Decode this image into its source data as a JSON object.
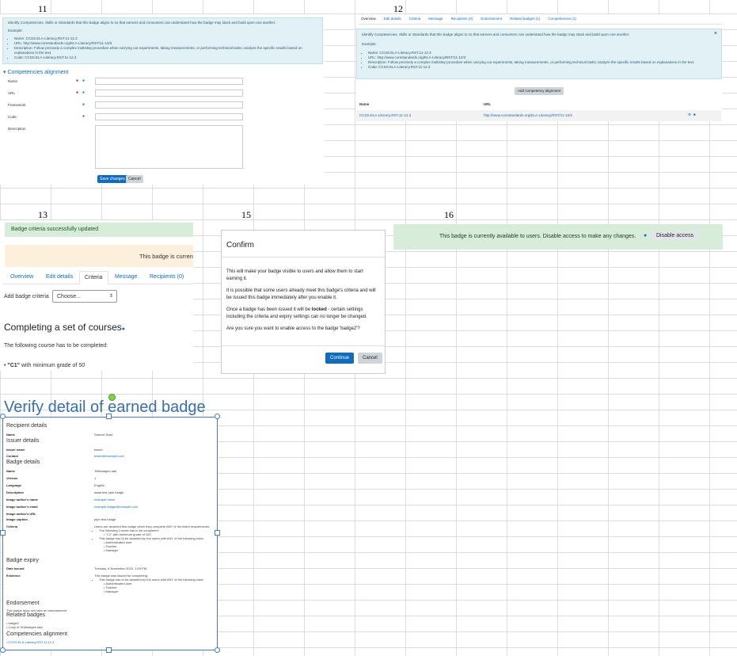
{
  "labels": {
    "s11": "11",
    "s12": "12",
    "s13": "13",
    "s15": "15",
    "s16": "16"
  },
  "p11": {
    "info": "Identify Competencies, Skills or Standards that this badge aligns to so that earners and consumers can understand how the badge may stack and build upon one another.",
    "example": "Example:",
    "ex1": "Name: CCSS.ELA-Literacy.RST.11-12.3",
    "ex2": "URL: http://www.corestandards.org/ELA-Literacy/RST/11-12/3",
    "ex3": "Description: Follow precisely a complex multistep procedure when carrying out experiments, taking measurements, or performing technical tasks; analyze the specific results based on explanations in the text.",
    "ex4": "Code: CCSS.ELA-Literacy.RST.11-12.3",
    "heading": "Competencies alignment",
    "f_name": "Name",
    "f_url": "URL",
    "f_framework": "Framework",
    "f_code": "Code",
    "f_desc": "Description",
    "save": "Save changes",
    "cancel": "Cancel"
  },
  "p12": {
    "tabs": [
      "Overview",
      "Edit details",
      "Criteria",
      "Message",
      "Recipients (0)",
      "Endorsement",
      "Related badges (1)",
      "Competencies (1)"
    ],
    "info": "Identify Competencies, Skills or Standards that this badge aligns to so that earners and consumers can understand how the badge may stack and build upon one another.",
    "example": "Example:",
    "ex1": "Name: CCSS.ELA-Literacy.RST.11-12.3",
    "ex2": "URL: http://www.corestandards.org/ELA-Literacy/RST/11-12/3",
    "ex3": "Description: Follow precisely a complex multistep procedure when carrying out experiments, taking measurements, or performing technical tasks; analyze the specific results based on explanations in the text.",
    "ex4": "Code: CCSS.ELA-Literacy.RST.11-12.3",
    "add": "Add competency alignment",
    "col_name": "Name",
    "col_url": "URL",
    "row_name": "CCSS.ELA-Literacy.RST.11-12.3",
    "row_url": "http://www.corestandards.org/ELA-Literacy/RST/11-12/3"
  },
  "p13": {
    "success": "Badge criteria successfully updated",
    "warning": "This badge is currently",
    "tabs": [
      "Overview",
      "Edit details",
      "Criteria",
      "Message",
      "Recipients (0)"
    ],
    "add_label": "Add badge criteria",
    "select": "Choose...",
    "heading": "Completing a set of courses",
    "sub": "The following course has to be completed:",
    "item_course": "\"C1\"",
    "item_rest": " with minimum grade of ",
    "item_grade": "50"
  },
  "p15": {
    "title": "Confirm",
    "p1": "This will make your badge visible to users and allow them to start earning it.",
    "p2": "It is possible that some users already meet this badge's criteria and will be issued this badge immediately after you enable it.",
    "p3a": "Once a badge has been issued it will be ",
    "p3b": "locked",
    "p3c": " - certain settings including the criteria and expiry settings can no longer be changed.",
    "p4": "Are you sure you want to enable access to the badge 'badge2'?",
    "continue": "Continue",
    "cancel": "Cancel"
  },
  "p16": {
    "text": "This badge is currently available to users. Disable access to make any changes.",
    "button": "Disable access"
  },
  "verify": {
    "title": "Verify detail of earned badge",
    "h_recipient": "Recipient details",
    "name_l": "Name",
    "name_v": "Samuel Salvi",
    "h_issuer": "Issuer details",
    "iname_l": "Issuer name",
    "iname_v": "Issuer",
    "contact_l": "Contact",
    "contact_v": "tester@example.com",
    "h_badge": "Badge details",
    "bname_l": "Name",
    "bname_v": "Testbadges aaa",
    "version_l": "Version",
    "version_v": "1",
    "lang_l": "Language",
    "lang_v": "English",
    "desc_l": "Description",
    "desc_v": "aaaa test pipe badge",
    "iauth_l": "Image author's name",
    "iauth_v": "example name",
    "iemail_l": "Image author's email",
    "iemail_v": "example-image@example.com",
    "iurl_l": "Image author's URL",
    "icap_l": "Image caption",
    "icap_v": "pipe test badge",
    "crit_l": "Criteria",
    "crit_v": "Users are awarded this badge when they complete ANY of the listed requirements:",
    "crit_1": "The following Course has to be completed:",
    "crit_1a": "\"C1\" with minimum grade of 100",
    "crit_2": "This badge has to be awarded by the users with ANY of the following roles:",
    "roles": [
      "Authenticated user",
      "Teacher",
      "Manager"
    ],
    "h_expiry": "Badge expiry",
    "issued_l": "Date issued",
    "issued_v": "Tuesday, 6 November 2019, 1:53 PM",
    "evid_l": "Evidence",
    "evid_v": "This badge was issued for completing:",
    "evid_1": "This badge has to be awarded by the users with ANY of the following roles:",
    "evid_roles": [
      "Authenticated user",
      "Teacher",
      "Manager"
    ],
    "h_endorse": "Endorsement",
    "endorse_v": "This badge does not have an endorsement.",
    "h_related": "Related badges",
    "related": [
      "badge2",
      "Copy of Testbadges aaa"
    ],
    "h_comp": "Competencies alignment",
    "comp": "CCSS.ELA-Literacy.RST.11-12.3"
  }
}
